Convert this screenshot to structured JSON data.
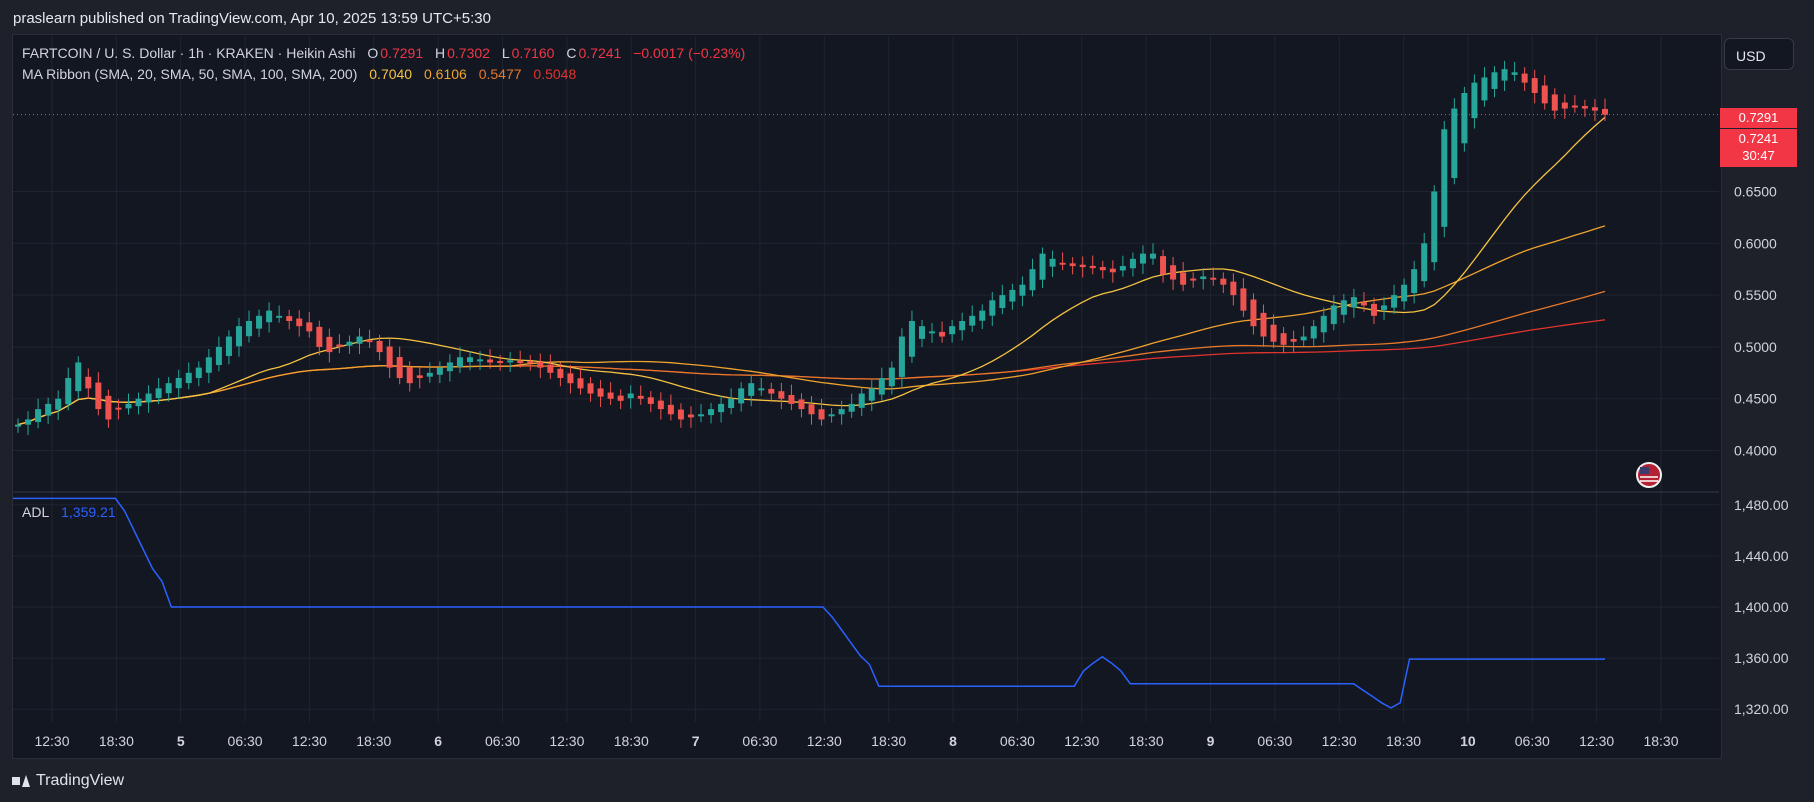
{
  "header": {
    "published": "praslearn published on TradingView.com, Apr 10, 2025 13:59 UTC+5:30"
  },
  "legend": {
    "symbol": "FARTCOIN / U. S. Dollar · 1h · KRAKEN · Heikin Ashi",
    "o_label": "O",
    "o_value": "0.7291",
    "h_label": "H",
    "h_value": "0.7302",
    "l_label": "L",
    "l_value": "0.7160",
    "c_label": "C",
    "c_value": "0.7241",
    "change": "−0.0017 (−0.23%)",
    "ma_label": "MA Ribbon (SMA, 20, SMA, 50, SMA, 100, SMA, 200)",
    "ma_values": [
      "0.7040",
      "0.6106",
      "0.5477",
      "0.5048"
    ]
  },
  "currency_button": "USD",
  "price_tags": {
    "last": "0.7291",
    "close": "0.7241",
    "countdown": "30:47"
  },
  "branding": "TradingView",
  "colors": {
    "up": "#26a69a",
    "down": "#ef5350",
    "ma20": "#f5c242",
    "ma50": "#f0a22e",
    "ma100": "#e6782a",
    "ma200": "#e0342c",
    "adl": "#2962ff"
  },
  "chart_data": [
    {
      "type": "candlestick",
      "style": "Heikin Ashi",
      "ylim": [
        0.36,
        0.8
      ],
      "y_ticks": [
        "0.6500",
        "0.6000",
        "0.5500",
        "0.5000",
        "0.4500",
        "0.4000"
      ],
      "x_ticks": [
        "12:30",
        "18:30",
        "5",
        "06:30",
        "12:30",
        "18:30",
        "6",
        "06:30",
        "12:30",
        "18:30",
        "7",
        "06:30",
        "12:30",
        "18:30",
        "8",
        "06:30",
        "12:30",
        "18:30",
        "9",
        "06:30",
        "12:30",
        "18:30",
        "10",
        "06:30",
        "12:30",
        "18:30"
      ],
      "close_series": [
        0.425,
        0.43,
        0.44,
        0.445,
        0.45,
        0.47,
        0.485,
        0.46,
        0.44,
        0.43,
        0.44,
        0.445,
        0.45,
        0.455,
        0.46,
        0.465,
        0.47,
        0.475,
        0.48,
        0.49,
        0.5,
        0.51,
        0.52,
        0.525,
        0.53,
        0.535,
        0.53,
        0.525,
        0.52,
        0.515,
        0.5,
        0.495,
        0.5,
        0.505,
        0.51,
        0.505,
        0.495,
        0.48,
        0.47,
        0.465,
        0.47,
        0.475,
        0.48,
        0.485,
        0.49,
        0.49,
        0.488,
        0.485,
        0.485,
        0.487,
        0.486,
        0.485,
        0.48,
        0.475,
        0.47,
        0.465,
        0.46,
        0.455,
        0.452,
        0.45,
        0.448,
        0.455,
        0.45,
        0.445,
        0.44,
        0.435,
        0.43,
        0.432,
        0.435,
        0.44,
        0.445,
        0.45,
        0.46,
        0.465,
        0.46,
        0.455,
        0.45,
        0.445,
        0.44,
        0.435,
        0.43,
        0.435,
        0.44,
        0.445,
        0.455,
        0.46,
        0.47,
        0.48,
        0.51,
        0.525,
        0.52,
        0.515,
        0.51,
        0.52,
        0.525,
        0.53,
        0.535,
        0.545,
        0.55,
        0.555,
        0.56,
        0.575,
        0.59,
        0.585,
        0.58,
        0.578,
        0.577,
        0.576,
        0.574,
        0.572,
        0.578,
        0.585,
        0.59,
        0.59,
        0.57,
        0.565,
        0.56,
        0.565,
        0.568,
        0.565,
        0.56,
        0.55,
        0.535,
        0.52,
        0.51,
        0.505,
        0.502,
        0.505,
        0.51,
        0.52,
        0.53,
        0.54,
        0.545,
        0.548,
        0.54,
        0.53,
        0.54,
        0.55,
        0.56,
        0.575,
        0.6,
        0.65,
        0.71,
        0.73,
        0.745,
        0.755,
        0.76,
        0.765,
        0.768,
        0.765,
        0.755,
        0.745,
        0.735,
        0.728,
        0.73,
        0.732,
        0.73,
        0.728,
        0.7241
      ],
      "series": [
        {
          "name": "SMA 20",
          "last": 0.704
        },
        {
          "name": "SMA 50",
          "last": 0.6106
        },
        {
          "name": "SMA 100",
          "last": 0.5477
        },
        {
          "name": "SMA 200",
          "last": 0.5048
        }
      ]
    },
    {
      "type": "line",
      "title": "ADL",
      "last_value": "1,359.21",
      "ylim": [
        1310,
        1490
      ],
      "y_ticks": [
        "1,480.00",
        "1,440.00",
        "1,400.00",
        "1,360.00",
        "1,320.00"
      ],
      "values": [
        1485,
        1485,
        1485,
        1485,
        1485,
        1485,
        1485,
        1485,
        1485,
        1485,
        1485,
        1485,
        1475,
        1460,
        1445,
        1430,
        1420,
        1400,
        1400,
        1400,
        1400,
        1400,
        1400,
        1400,
        1400,
        1400,
        1400,
        1400,
        1400,
        1400,
        1400,
        1400,
        1400,
        1400,
        1400,
        1400,
        1400,
        1400,
        1400,
        1400,
        1400,
        1400,
        1400,
        1400,
        1400,
        1400,
        1400,
        1400,
        1400,
        1400,
        1400,
        1400,
        1400,
        1400,
        1400,
        1400,
        1400,
        1400,
        1400,
        1400,
        1400,
        1400,
        1400,
        1400,
        1400,
        1400,
        1400,
        1400,
        1400,
        1400,
        1400,
        1400,
        1400,
        1400,
        1400,
        1400,
        1400,
        1400,
        1400,
        1400,
        1400,
        1400,
        1400,
        1400,
        1400,
        1400,
        1400,
        1400,
        1392,
        1382,
        1372,
        1362,
        1355,
        1338,
        1338,
        1338,
        1338,
        1338,
        1338,
        1338,
        1338,
        1338,
        1338,
        1338,
        1338,
        1338,
        1338,
        1338,
        1338,
        1338,
        1338,
        1338,
        1338,
        1338,
        1338,
        1350,
        1356,
        1361,
        1356,
        1350,
        1340,
        1340,
        1340,
        1340,
        1340,
        1340,
        1340,
        1340,
        1340,
        1340,
        1340,
        1340,
        1340,
        1340,
        1340,
        1340,
        1340,
        1340,
        1340,
        1340,
        1340,
        1340,
        1340,
        1340,
        1340,
        1335,
        1330,
        1325,
        1321,
        1325,
        1359.21,
        1359.21,
        1359.21,
        1359.21,
        1359.21,
        1359.21,
        1359.21,
        1359.21,
        1359.21,
        1359.21,
        1359.21,
        1359.21,
        1359.21,
        1359.21,
        1359.21,
        1359.21,
        1359.21,
        1359.21,
        1359.21,
        1359.21,
        1359.21,
        1359.21
      ]
    }
  ]
}
